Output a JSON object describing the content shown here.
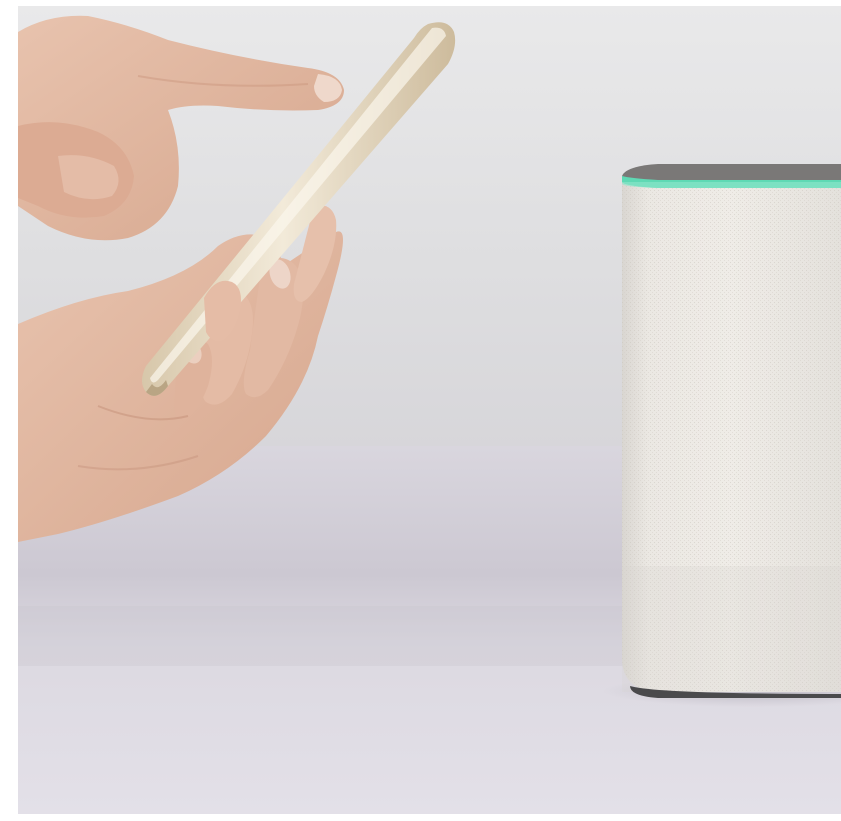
{
  "image": {
    "kind": "photograph",
    "subjects": [
      "hands-holding-smartphone",
      "smart-speaker"
    ],
    "colors": {
      "wall_top": "#e6e6e7",
      "wall_bottom": "#dcdcde",
      "table": "#dedbe2",
      "table_shadow": "#cfcbd5",
      "skin": "#e2b9a3",
      "skin_shadow": "#c8957d",
      "phone": "#e8dcc6",
      "phone_edge": "#c9b89b",
      "speaker_fabric": "#ece9e4",
      "speaker_top": "#7d7b7a",
      "light_ring": "#5fd9b4"
    }
  }
}
